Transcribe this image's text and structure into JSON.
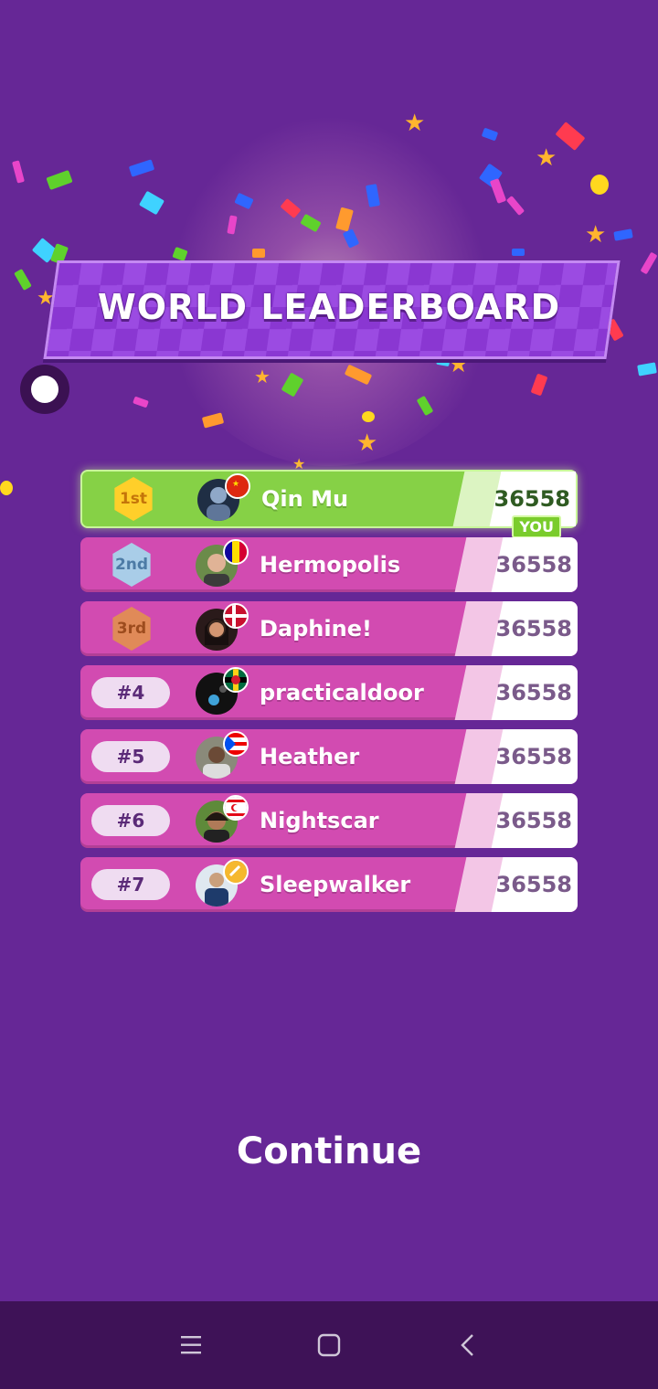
{
  "header": {
    "title": "WORLD LEADERBOARD"
  },
  "leaderboard": {
    "rows": [
      {
        "rank": "1st",
        "name": "Qin Mu",
        "score": "36558",
        "flag": "china-flag",
        "is_you": true
      },
      {
        "rank": "2nd",
        "name": "Hermopolis",
        "score": "36558",
        "flag": "andorra-flag"
      },
      {
        "rank": "3rd",
        "name": "Daphine!",
        "score": "36558",
        "flag": "denmark-flag"
      },
      {
        "rank": "#4",
        "name": "practicaldoor",
        "score": "36558",
        "flag": "dominica-flag"
      },
      {
        "rank": "#5",
        "name": "Heather",
        "score": "36558",
        "flag": "puerto-rico-flag"
      },
      {
        "rank": "#6",
        "name": "Nightscar",
        "score": "36558",
        "flag": "northern-cyprus-flag"
      },
      {
        "rank": "#7",
        "name": "Sleepwalker",
        "score": "36558",
        "flag": "gold-badge"
      }
    ],
    "you_label": "YOU"
  },
  "actions": {
    "continue_label": "Continue"
  },
  "colors": {
    "background": "#662796",
    "row": "#d24bb1",
    "me_row": "#86d146",
    "navbar": "#3e1257"
  },
  "navbar": {
    "icons": [
      "menu-icon",
      "home-icon",
      "back-icon"
    ]
  }
}
